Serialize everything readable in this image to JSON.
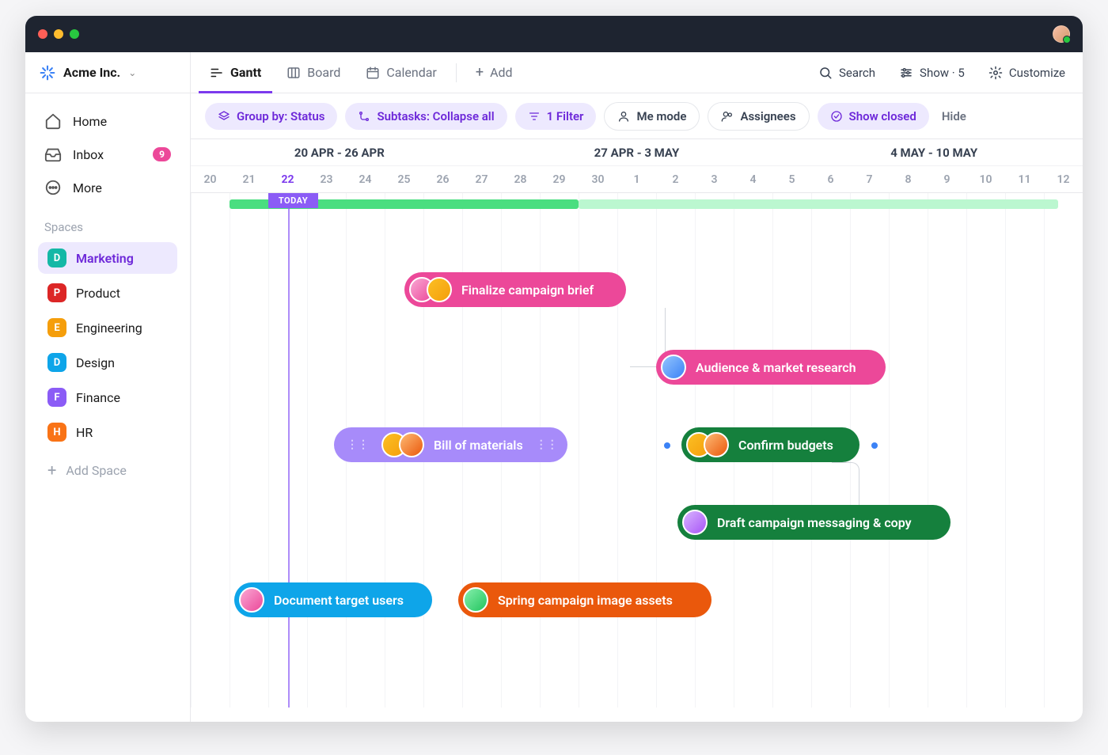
{
  "workspace": {
    "name": "Acme Inc."
  },
  "nav": {
    "home": "Home",
    "inbox": "Inbox",
    "inbox_badge": "9",
    "more": "More"
  },
  "spaces_label": "Spaces",
  "spaces": [
    {
      "letter": "D",
      "name": "Marketing",
      "color": "#14b8a6",
      "active": true
    },
    {
      "letter": "P",
      "name": "Product",
      "color": "#dc2626"
    },
    {
      "letter": "E",
      "name": "Engineering",
      "color": "#f59e0b"
    },
    {
      "letter": "D",
      "name": "Design",
      "color": "#0ea5e9"
    },
    {
      "letter": "F",
      "name": "Finance",
      "color": "#8b5cf6"
    },
    {
      "letter": "H",
      "name": "HR",
      "color": "#f97316"
    }
  ],
  "add_space": "Add Space",
  "view_tabs": {
    "gantt": "Gantt",
    "board": "Board",
    "calendar": "Calendar",
    "add": "Add"
  },
  "toolbar_right": {
    "search": "Search",
    "show": "Show · 5",
    "customize": "Customize"
  },
  "filters": {
    "group_by": "Group by: Status",
    "subtasks": "Subtasks: Collapse all",
    "filter": "1 Filter",
    "me_mode": "Me mode",
    "assignees": "Assignees",
    "show_closed": "Show closed",
    "hide": "Hide"
  },
  "weeks": [
    "20 APR - 26 APR",
    "27 APR - 3 MAY",
    "4 MAY - 10 MAY"
  ],
  "days": [
    "20",
    "21",
    "22",
    "23",
    "24",
    "25",
    "26",
    "27",
    "28",
    "29",
    "30",
    "1",
    "2",
    "3",
    "4",
    "5",
    "6",
    "7",
    "8",
    "9",
    "10",
    "11",
    "12"
  ],
  "today_label": "TODAY",
  "today_index": 2,
  "tasks": {
    "finalize": "Finalize campaign brief",
    "audience": "Audience & market research",
    "bom": "Bill of materials",
    "budgets": "Confirm budgets",
    "draft": "Draft campaign messaging & copy",
    "document": "Document target users",
    "spring": "Spring campaign image assets"
  }
}
